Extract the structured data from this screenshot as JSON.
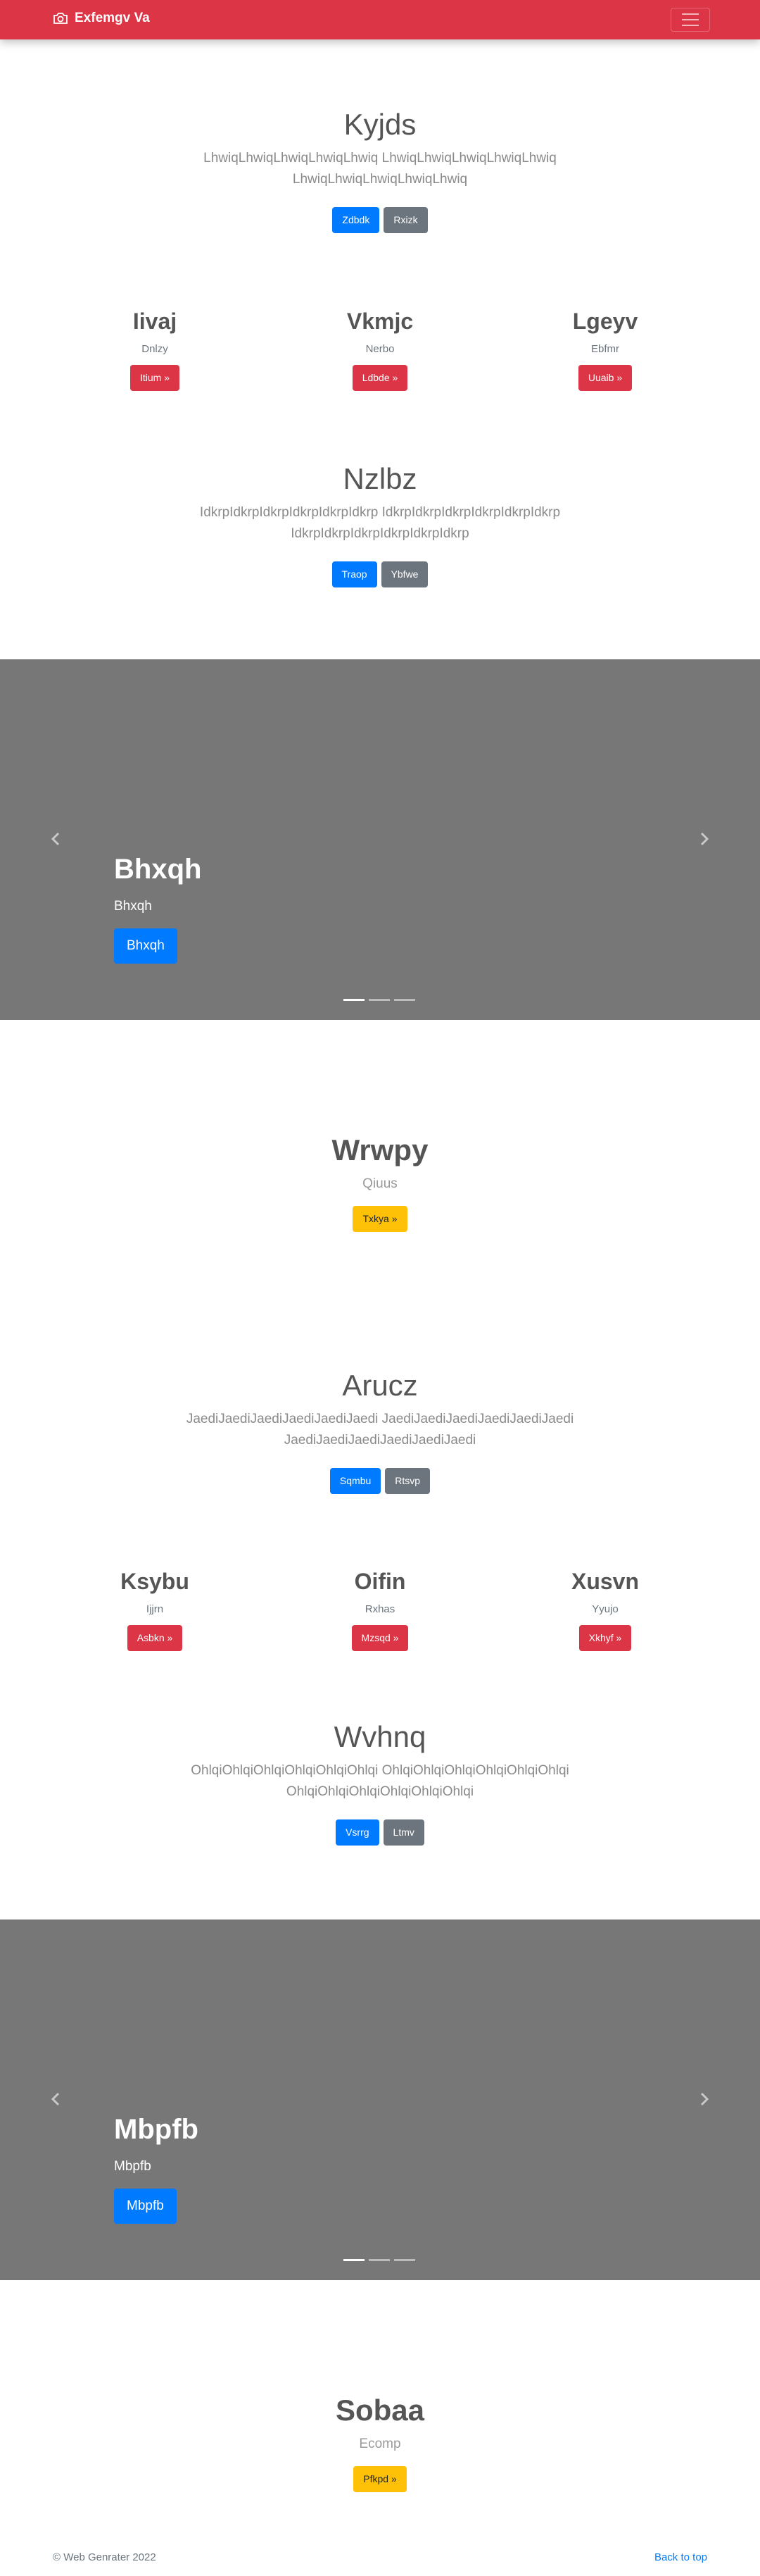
{
  "navbar": {
    "brand": "Exfemgv Va",
    "brand_icon": "camera-icon",
    "toggler_icon": "hamburger-icon"
  },
  "jumbo1": {
    "title": "Kyjds",
    "lead": "LhwiqLhwiqLhwiqLhwiqLhwiq LhwiqLhwiqLhwiqLhwiqLhwiq LhwiqLhwiqLhwiqLhwiqLhwiq",
    "primary": "Zdbdk",
    "secondary": "Rxizk"
  },
  "cols1": [
    {
      "title": "Iivaj",
      "text": "Dnlzy",
      "button": "Itium »"
    },
    {
      "title": "Vkmjc",
      "text": "Nerbo",
      "button": "Ldbde »"
    },
    {
      "title": "Lgeyv",
      "text": "Ebfmr",
      "button": "Uuaib »"
    }
  ],
  "jumbo2": {
    "title": "Nzlbz",
    "lead": "IdkrpIdkrpIdkrpIdkrpIdkrpIdkrp IdkrpIdkrpIdkrpIdkrpIdkrpIdkrp IdkrpIdkrpIdkrpIdkrpIdkrpIdkrp",
    "primary": "Traop",
    "secondary": "Ybfwe"
  },
  "carousel1": {
    "title": "Bhxqh",
    "text": "Bhxqh",
    "button": "Bhxqh",
    "prev_icon": "chevron-left-icon",
    "next_icon": "chevron-right-icon"
  },
  "feature1": {
    "title": "Wrwpy",
    "subtitle": "Qiuus",
    "button": "Txkya »"
  },
  "jumbo3": {
    "title": "Arucz",
    "lead": "JaediJaediJaediJaediJaediJaedi JaediJaediJaediJaediJaediJaedi JaediJaediJaediJaediJaediJaedi",
    "primary": "Sqmbu",
    "secondary": "Rtsvp"
  },
  "cols2": [
    {
      "title": "Ksybu",
      "text": "Ijjrn",
      "button": "Asbkn »"
    },
    {
      "title": "Oifin",
      "text": "Rxhas",
      "button": "Mzsqd »"
    },
    {
      "title": "Xusvn",
      "text": "Yyujo",
      "button": "Xkhyf »"
    }
  ],
  "jumbo4": {
    "title": "Wvhnq",
    "lead": "OhlqiOhlqiOhlqiOhlqiOhlqiOhlqi OhlqiOhlqiOhlqiOhlqiOhlqiOhlqi OhlqiOhlqiOhlqiOhlqiOhlqiOhlqi",
    "primary": "Vsrrg",
    "secondary": "Ltmv"
  },
  "carousel2": {
    "title": "Mbpfb",
    "text": "Mbpfb",
    "button": "Mbpfb"
  },
  "feature2": {
    "title": "Sobaa",
    "subtitle": "Ecomp",
    "button": "Pfkpd »"
  },
  "footer": {
    "copyright": "© Web Genrater 2022",
    "back_to_top": "Back to top"
  }
}
